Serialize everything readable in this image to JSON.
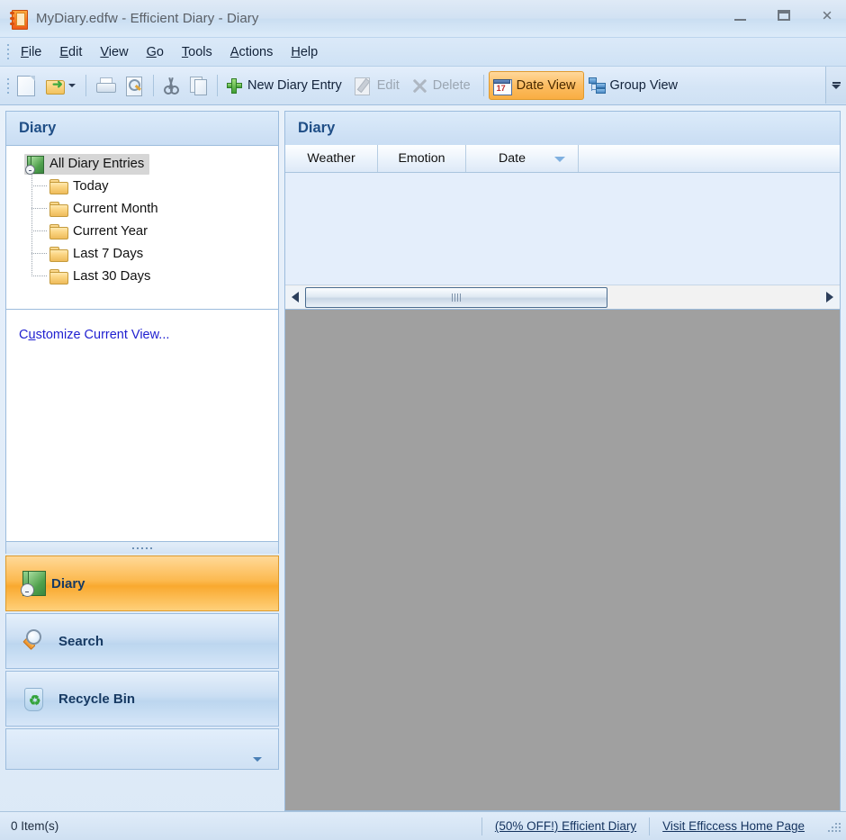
{
  "window": {
    "title": "MyDiary.edfw - Efficient Diary - Diary",
    "app_icon": "diary-book-icon",
    "controls": {
      "minimize": "minimize-icon",
      "maximize": "maximize-icon",
      "close": "✕"
    }
  },
  "menubar": {
    "items": [
      {
        "label": "File",
        "accel": "F"
      },
      {
        "label": "Edit",
        "accel": "E"
      },
      {
        "label": "View",
        "accel": "V"
      },
      {
        "label": "Go",
        "accel": "G"
      },
      {
        "label": "Tools",
        "accel": "T"
      },
      {
        "label": "Actions",
        "accel": "A"
      },
      {
        "label": "Help",
        "accel": "H"
      }
    ]
  },
  "toolbar": {
    "new_file": "new-file-icon",
    "open_file": "open-folder-icon",
    "open_dropdown": "chevron-down-icon",
    "print": "print-icon",
    "print_preview": "print-preview-icon",
    "cut": "cut-icon",
    "copy": "copy-icon",
    "new_entry_label": "New Diary Entry",
    "edit_label": "Edit",
    "delete_label": "Delete",
    "date_view_label": "Date View",
    "group_view_label": "Group View",
    "overflow": "toolbar-overflow-icon",
    "active_view": "Date View",
    "active_color": "#f9a92f"
  },
  "sidebar": {
    "header": "Diary",
    "tree": {
      "root": {
        "label": "All Diary Entries",
        "selected": true,
        "icon": "diary-book-icon"
      },
      "children": [
        {
          "label": "Today",
          "icon": "folder-icon"
        },
        {
          "label": "Current Month",
          "icon": "folder-icon"
        },
        {
          "label": "Current Year",
          "icon": "folder-icon"
        },
        {
          "label": "Last 7 Days",
          "icon": "folder-icon"
        },
        {
          "label": "Last 30 Days",
          "icon": "folder-icon"
        }
      ]
    },
    "customize_link": {
      "prefix": "C",
      "accel": "u",
      "suffix": "stomize Current View..."
    },
    "nav_buttons": [
      {
        "label": "Diary",
        "icon": "diary-book-icon",
        "active": true
      },
      {
        "label": "Search",
        "icon": "search-icon",
        "active": false
      },
      {
        "label": "Recycle Bin",
        "icon": "recycle-bin-icon",
        "active": false
      }
    ]
  },
  "main": {
    "header": "Diary",
    "columns": [
      {
        "label": "Weather"
      },
      {
        "label": "Emotion"
      },
      {
        "label": "Date",
        "sorted": "descending"
      }
    ],
    "rows": []
  },
  "statusbar": {
    "item_count": "0 Item(s)",
    "promo_link": "(50% OFF!) Efficient Diary",
    "home_link": "Visit Efficcess Home Page"
  }
}
